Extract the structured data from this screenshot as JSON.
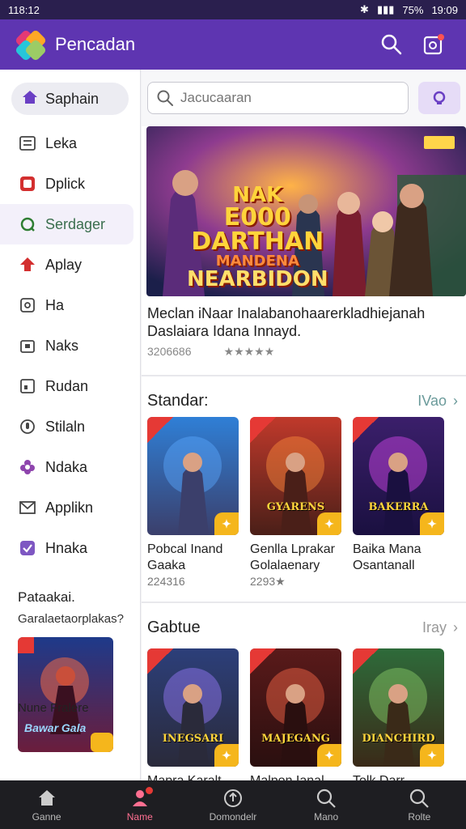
{
  "status": {
    "time": "118:12",
    "signal": "75%",
    "clock": "19:09"
  },
  "app": {
    "title": "Pencadan"
  },
  "search": {
    "placeholder": "Jacucaaran"
  },
  "sidebar": {
    "home_label": "Saphain",
    "items": [
      {
        "label": "Leka",
        "icon": "list-icon"
      },
      {
        "label": "Dplick",
        "icon": "square-icon"
      },
      {
        "label": "Serdager",
        "icon": "refresh-icon",
        "active": true
      },
      {
        "label": "Aplay",
        "icon": "play-icon"
      },
      {
        "label": "Ha",
        "icon": "tag-icon"
      },
      {
        "label": "Naks",
        "icon": "bag-icon"
      },
      {
        "label": "Rudan",
        "icon": "grid-icon"
      },
      {
        "label": "Stilaln",
        "icon": "mic-icon"
      },
      {
        "label": "Ndaka",
        "icon": "flower-icon"
      },
      {
        "label": "Applikn",
        "icon": "mail-icon"
      },
      {
        "label": "Hnaka",
        "icon": "check-icon"
      }
    ],
    "section_title": "Pataakai.",
    "section_subtitle": "Garalaetaorplakas?",
    "promo_text": "Bawar Gala",
    "promo_title": "Nune Fralere"
  },
  "featured": {
    "banner_lines": [
      "NAK",
      "E000",
      "DARTHAN",
      "MANDENA",
      "NEARBIDON"
    ],
    "description": "Meclan iNaar Inalabanohaarerkladhiejanah Daslaiara Idana Innayd.",
    "downloads": "3206686",
    "rating": "★★★★★"
  },
  "section1": {
    "title": "Standar:",
    "more": "IVao",
    "cards": [
      {
        "name": "Pobcal Inand Gaaka",
        "meta": "224316",
        "poster": ""
      },
      {
        "name": "Genlla Lprakar Golalaenary",
        "meta": "2293★",
        "poster": "GYARENS"
      },
      {
        "name": "Baika Mana Osantanall",
        "meta": "",
        "poster": "BAKERRA"
      }
    ]
  },
  "section2": {
    "title": "Gabtue",
    "more": "Iray",
    "cards": [
      {
        "name": "Mapra Karalt",
        "poster": "INEGSARI"
      },
      {
        "name": "Malpon Ianal",
        "poster": "MAJEGANG"
      },
      {
        "name": "Tolk Darr",
        "poster": "DIANCHIRD"
      }
    ]
  },
  "bottomnav": {
    "items": [
      {
        "label": "Ganne",
        "icon": "home-icon"
      },
      {
        "label": "Name",
        "icon": "person-icon",
        "active": true
      },
      {
        "label": "Domondelr",
        "icon": "download-icon"
      },
      {
        "label": "Mano",
        "icon": "search-icon"
      },
      {
        "label": "Rolte",
        "icon": "search-icon"
      }
    ]
  },
  "colors": {
    "primary": "#5e35b1",
    "accent": "#f5b61c",
    "nav_bg": "#1e1e22"
  }
}
